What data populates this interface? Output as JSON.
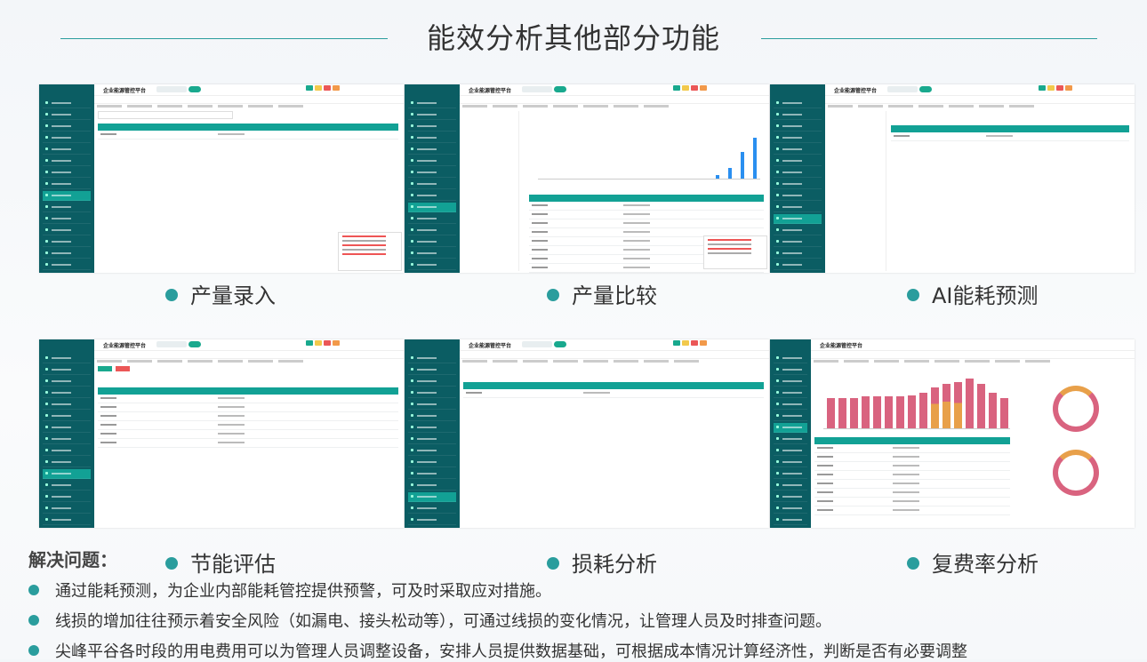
{
  "page": {
    "title": "能效分析其他部分功能",
    "app_name": "企业能源管控平台"
  },
  "features": [
    {
      "caption": "产量录入"
    },
    {
      "caption": "产量比较"
    },
    {
      "caption": "AI能耗预测"
    },
    {
      "caption": "节能评估"
    },
    {
      "caption": "损耗分析"
    },
    {
      "caption": "复费率分析"
    }
  ],
  "solve": {
    "heading": "解决问题：",
    "items": [
      "通过能耗预测，为企业内部能耗管控提供预警，可及时采取应对措施。",
      "线损的增加往往预示着安全风险（如漏电、接头松动等），可通过线损的变化情况，让管理人员及时排查问题。",
      "尖峰平谷各时段的用电费用可以为管理人员调整设备，安排人员提供数据基础，可根据成本情况计算经济性，判断是否有必要调整"
    ]
  },
  "colors": {
    "accent": "#2a9d9d",
    "sidebar": "#0b5d63",
    "header": "#12a195",
    "bar_blue": "#2a8ff0",
    "bar_pink": "#d9637f",
    "bar_orange": "#e8a04a"
  }
}
